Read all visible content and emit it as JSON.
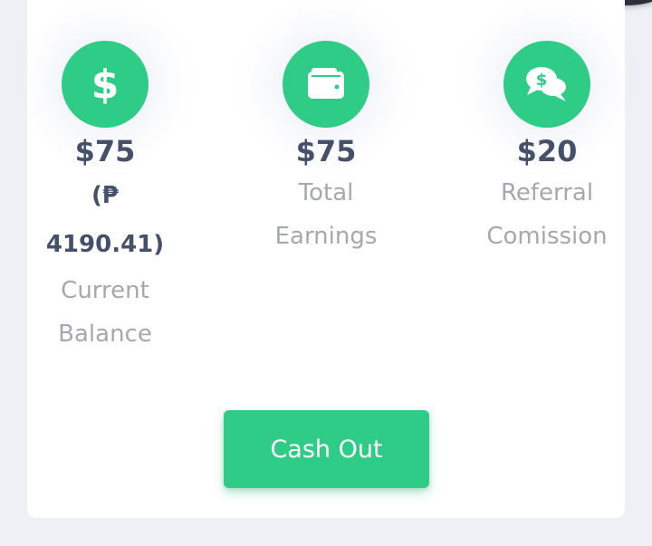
{
  "theme": {
    "accent": "#2ecc87",
    "amount_color": "#45506b",
    "label_color": "#a5a8ae",
    "background": "#eef0f6"
  },
  "stats": [
    {
      "icon": "dollar-icon",
      "amount": "$75",
      "sub_amount_line1": "(₱",
      "sub_amount_line2": "4190.41)",
      "label_line1": "Current",
      "label_line2": "Balance"
    },
    {
      "icon": "wallet-icon",
      "amount": "$75",
      "label_line1": "Total",
      "label_line2": "Earnings"
    },
    {
      "icon": "chat-dollar-icon",
      "amount": "$20",
      "label_line1": "Referral",
      "label_line2": "Comission"
    }
  ],
  "cash_out": {
    "label": "Cash Out"
  }
}
